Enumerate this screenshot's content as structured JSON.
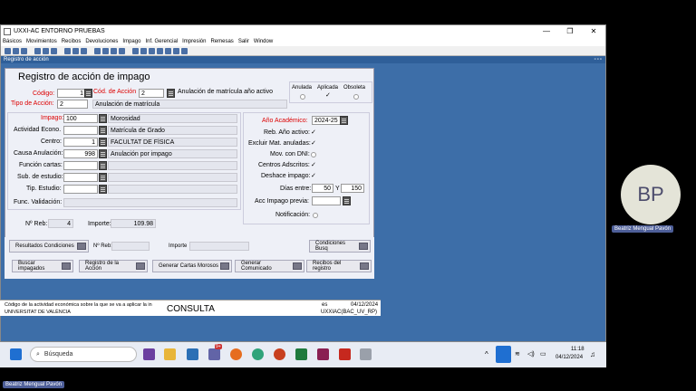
{
  "window": {
    "title": "UXXI-AC ENTORNO PRUEBAS",
    "minimize": "—",
    "maximize": "❐",
    "close": "✕"
  },
  "menu": [
    "Básicos",
    "Movimientos",
    "Recibos",
    "Devoluciones",
    "Impago",
    "Inf. Gerencial",
    "Impresión",
    "Remesas",
    "Salir",
    "Window"
  ],
  "subwindow": {
    "title": "Registro de acción",
    "controls": "▫▫▫"
  },
  "form": {
    "title": "Registro de acción de impago",
    "codigo_label": "Código:",
    "codigo_value": "1",
    "cod_accion_label": "Cód. de Acción",
    "cod_accion_value": "2",
    "cod_accion_desc": "Anulación de matrícula año activo",
    "tipo_accion_label": "Tipo de Acción:",
    "tipo_accion_value": "2",
    "tipo_accion_desc": "Anulación de matrícula",
    "estado": {
      "anulada": "Anulada",
      "aplicada": "Aplicada",
      "obsoleta": "Obsoleta"
    },
    "impago_label": "Impago:",
    "impago_value": "100",
    "impago_desc": "Morosidad",
    "actividad_label": "Actividad Econo.",
    "actividad_value": "",
    "actividad_desc": "Matrícula de Grado",
    "centro_label": "Centro:",
    "centro_value": "1",
    "centro_desc": "FACULTAT DE FÍSICA",
    "causa_label": "Causa Anulación:",
    "causa_value": "998",
    "causa_desc": "Anulación por impago",
    "funcion_label": "Función cartas:",
    "sub_estudio_label": "Sub. de estudio:",
    "tip_estudio_label": "Tip. Estudio:",
    "func_validacion_label": "Func. Validación:",
    "anio_label": "Año Académico:",
    "anio_value": "2024-25",
    "reb_anio_label": "Reb. Año activo:",
    "excluir_label": "Excluir Mat. anuladas:",
    "mov_dni_label": "Mov. con DNI:",
    "centros_label": "Centros Adscritos:",
    "deshace_label": "Deshace impago:",
    "dias_label": "Días entre:",
    "dias_from": "50",
    "dias_y": "Y",
    "dias_to": "150",
    "acc_previa_label": "Acc Impago previa:",
    "notificacion_label": "Notificación:",
    "nreb_label": "Nº Reb:",
    "nreb_value": "4",
    "importe_label": "Importe:",
    "importe_value": "109.98"
  },
  "buttons": {
    "resultados": "Resultados Condiciones",
    "nreb2": "Nº Reb:",
    "importe2": "Importe",
    "condiciones": "Condiciones Busq",
    "buscar": "Buscar impagados",
    "registro": "Registro de la Acción",
    "generar_cartas": "Generar Cartas Morosos",
    "generar_comunicado": "Generar Comunicado",
    "recibos": "Recibos del registro"
  },
  "status": {
    "hint": "Código de la actividad económica sobre la que se va a aplicar la in",
    "org": "UNIVERSITAT DE VALÈNCIA",
    "mode": "CONSULTA",
    "lang": "es",
    "date": "04/12/2024",
    "user": "UXXIAC(BAC_UV_RP)"
  },
  "taskbar": {
    "search_placeholder": "Búsqueda",
    "time": "11:18",
    "date": "04/12/2024",
    "badge": "9+"
  },
  "participant": {
    "initials": "BP",
    "name": "Beatriz Mengual Pavón"
  }
}
